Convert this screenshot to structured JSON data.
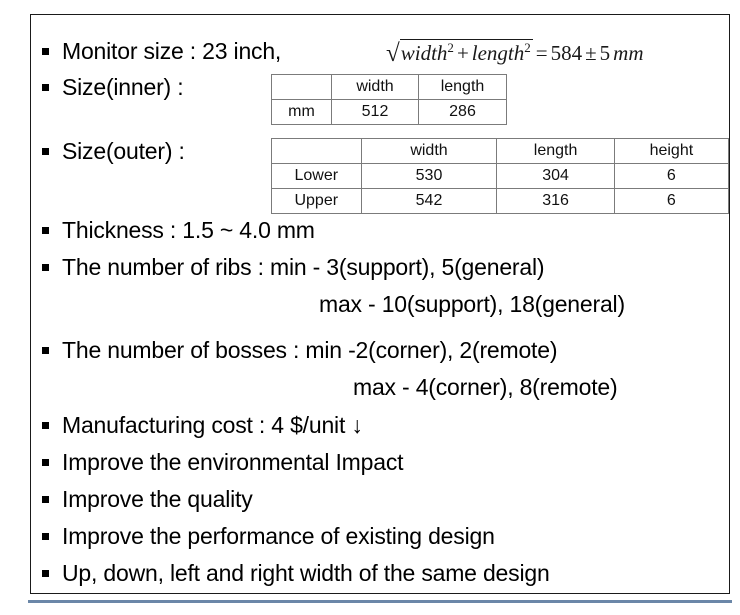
{
  "slide": {
    "accent_color": "#6b87a8",
    "frame_color": "#1a1a1a",
    "table_border_color": "#7b7b7b"
  },
  "bullets": {
    "monitor_size": "Monitor size : 23 inch,",
    "size_inner": "Size(inner) :",
    "size_outer": "Size(outer) :",
    "thickness": "Thickness : 1.5 ~ 4.0 mm",
    "ribs_min": "The number of ribs : min - 3(support), 5(general)",
    "ribs_max": "max - 10(support), 18(general)",
    "bosses_min": "The number of bosses : min -2(corner), 2(remote)",
    "bosses_max": "max - 4(corner), 8(remote)",
    "manufacturing_cost": "Manufacturing cost : 4 $/unit  ↓",
    "improve_environmental": "Improve the environmental Impact",
    "improve_quality": "Improve the quality",
    "improve_performance": "Improve the performance of existing design",
    "same_design_width": "Up, down, left and right width of the same design"
  },
  "formula": {
    "radical_symbol": "√",
    "term1_base": "width",
    "term1_exp": "2",
    "plus": "+",
    "term2_base": "length",
    "term2_exp": "2",
    "equals": "=",
    "value": "584",
    "plusminus": "±",
    "tolerance": "5",
    "unit": "mm",
    "full_text": "√(width² + length²) = 584 ± 5 mm"
  },
  "table_inner": {
    "caption": "Size(inner)",
    "headers": [
      "",
      "width",
      "length"
    ],
    "rows": [
      [
        "mm",
        "512",
        "286"
      ]
    ]
  },
  "table_outer": {
    "caption": "Size(outer)",
    "headers": [
      "",
      "width",
      "length",
      "height"
    ],
    "rows": [
      [
        "Lower",
        "530",
        "304",
        "6"
      ],
      [
        "Upper",
        "542",
        "316",
        "6"
      ]
    ]
  }
}
